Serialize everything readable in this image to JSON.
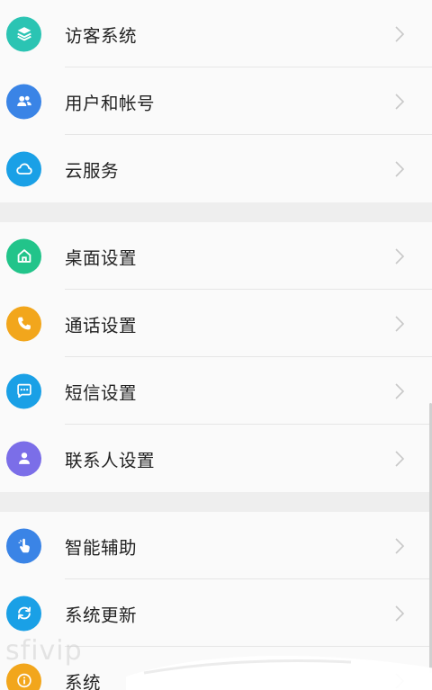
{
  "colors": {
    "visitor_system": "#2bc4b3",
    "users_accounts": "#3a84e6",
    "cloud_service": "#1aa0e6",
    "desktop": "#22c48a",
    "calls": "#f2a61c",
    "messages": "#1aa0e6",
    "contacts": "#7b6ee8",
    "smart_assist": "#3a84e6",
    "system_update": "#1aa0e6",
    "system": "#f2a61c"
  },
  "groups": [
    {
      "items": [
        {
          "label": "访客系统",
          "icon": "layers-icon"
        },
        {
          "label": "用户和帐号",
          "icon": "users-icon"
        },
        {
          "label": "云服务",
          "icon": "cloud-icon"
        }
      ]
    },
    {
      "items": [
        {
          "label": "桌面设置",
          "icon": "home-icon"
        },
        {
          "label": "通话设置",
          "icon": "phone-icon"
        },
        {
          "label": "短信设置",
          "icon": "message-icon"
        },
        {
          "label": "联系人设置",
          "icon": "contact-icon"
        }
      ]
    },
    {
      "items": [
        {
          "label": "智能辅助",
          "icon": "hand-pointer-icon"
        },
        {
          "label": "系统更新",
          "icon": "refresh-icon"
        },
        {
          "label": "系统",
          "icon": "info-icon"
        }
      ]
    }
  ],
  "watermark": "sfivip"
}
